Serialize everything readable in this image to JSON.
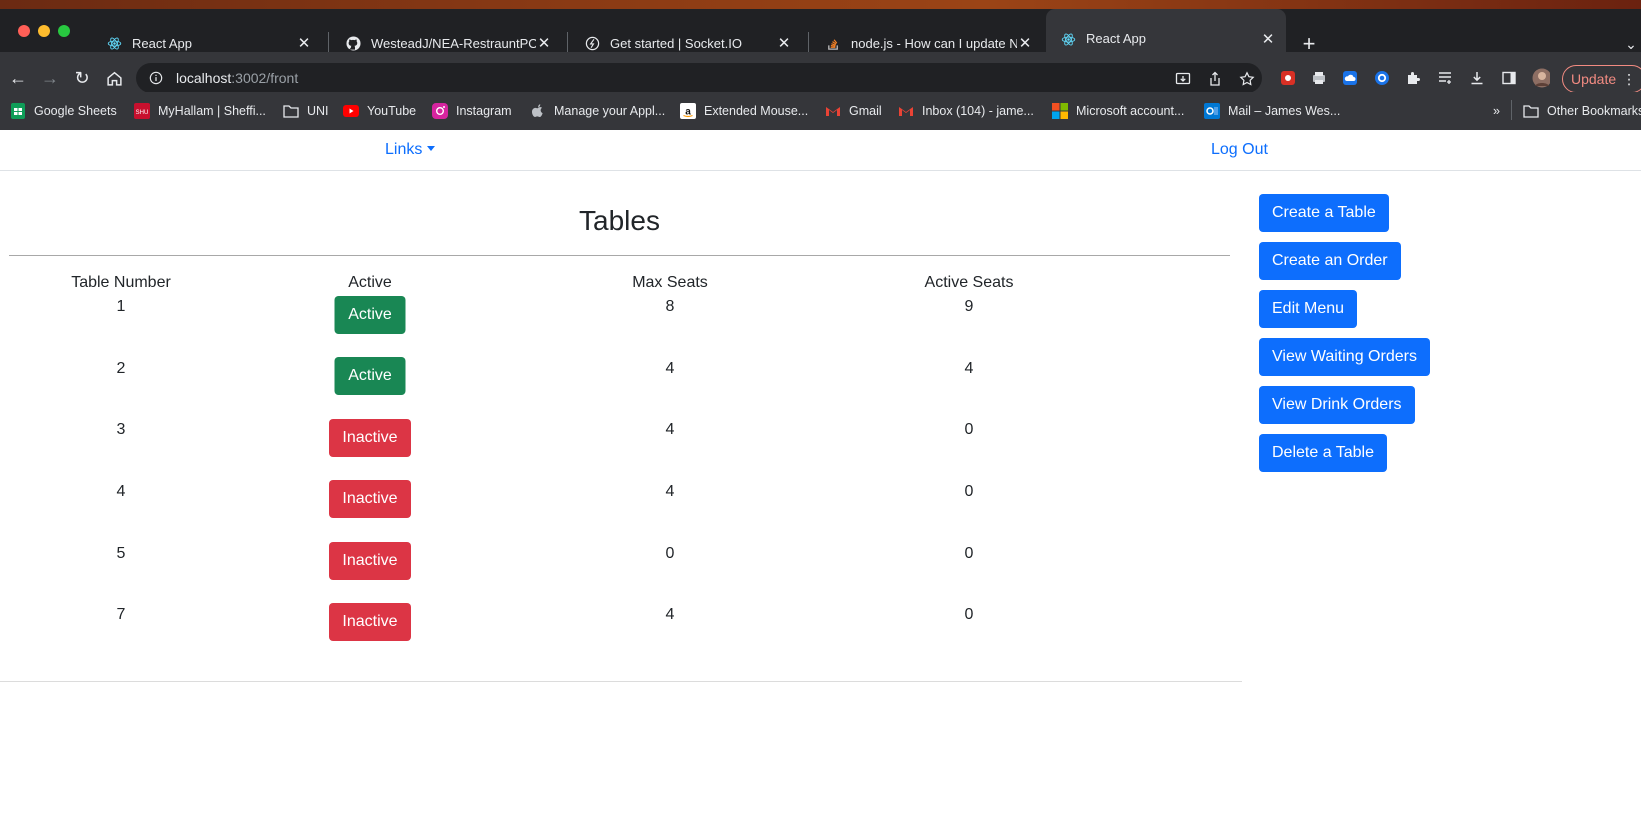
{
  "browser": {
    "tabs": [
      {
        "title": "React App",
        "icon": "react-icon",
        "active": false
      },
      {
        "title": "WesteadJ/NEA-RestrauntPOS",
        "icon": "github-icon",
        "active": false
      },
      {
        "title": "Get started | Socket.IO",
        "icon": "socketio-icon",
        "active": false
      },
      {
        "title": "node.js - How can I update Noc",
        "icon": "stackoverflow-icon",
        "active": false
      },
      {
        "title": "React App",
        "icon": "react-icon",
        "active": true
      }
    ],
    "url_host": "localhost",
    "url_path": ":3002/front",
    "update_label": "Update",
    "bookmarks": [
      {
        "label": "Google Sheets",
        "icon": "sheets-icon"
      },
      {
        "label": "MyHallam | Sheffi...",
        "icon": "shu-icon"
      },
      {
        "label": "UNI",
        "icon": "folder-icon"
      },
      {
        "label": "YouTube",
        "icon": "youtube-icon"
      },
      {
        "label": "Instagram",
        "icon": "instagram-icon"
      },
      {
        "label": "Manage your Appl...",
        "icon": "apple-icon"
      },
      {
        "label": "Extended Mouse...",
        "icon": "amazon-icon"
      },
      {
        "label": "Gmail",
        "icon": "gmail-icon"
      },
      {
        "label": "Inbox (104) - jame...",
        "icon": "gmail-icon"
      },
      {
        "label": "Microsoft account...",
        "icon": "microsoft-icon"
      },
      {
        "label": "Mail – James Wes...",
        "icon": "outlook-icon"
      }
    ],
    "bookmarks_overflow": "»",
    "other_bookmarks": "Other Bookmarks"
  },
  "nav": {
    "links_label": "Links",
    "logout_label": "Log Out"
  },
  "page": {
    "title": "Tables",
    "columns": [
      "Table Number",
      "Active",
      "Max Seats",
      "Active Seats"
    ],
    "rows": [
      {
        "number": "1",
        "status": "Active",
        "max_seats": "8",
        "active_seats": "9"
      },
      {
        "number": "2",
        "status": "Active",
        "max_seats": "4",
        "active_seats": "4"
      },
      {
        "number": "3",
        "status": "Inactive",
        "max_seats": "4",
        "active_seats": "0"
      },
      {
        "number": "4",
        "status": "Inactive",
        "max_seats": "4",
        "active_seats": "0"
      },
      {
        "number": "5",
        "status": "Inactive",
        "max_seats": "0",
        "active_seats": "0"
      },
      {
        "number": "7",
        "status": "Inactive",
        "max_seats": "4",
        "active_seats": "0"
      }
    ],
    "actions": [
      "Create a Table",
      "Create an Order",
      "Edit Menu",
      "View Waiting Orders",
      "View Drink Orders",
      "Delete a Table"
    ]
  },
  "colors": {
    "primary": "#0d6efd",
    "success": "#198754",
    "danger": "#dc3545"
  }
}
